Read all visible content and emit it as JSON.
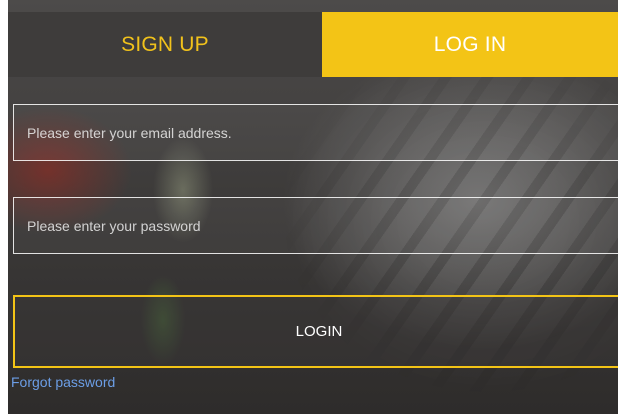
{
  "tabs": {
    "signup_label": "SIGN UP",
    "login_label": "LOG IN",
    "active": "LOG IN"
  },
  "form": {
    "email_placeholder": "Please enter your email address.",
    "email_value": "",
    "password_placeholder": "Please enter your password",
    "password_value": "",
    "login_button_label": "LOGIN",
    "forgot_password_label": "Forgot password"
  },
  "colors": {
    "accent": "#f3c416",
    "tab_inactive_bg": "#3e3c3b",
    "link": "#6c9ee6"
  }
}
